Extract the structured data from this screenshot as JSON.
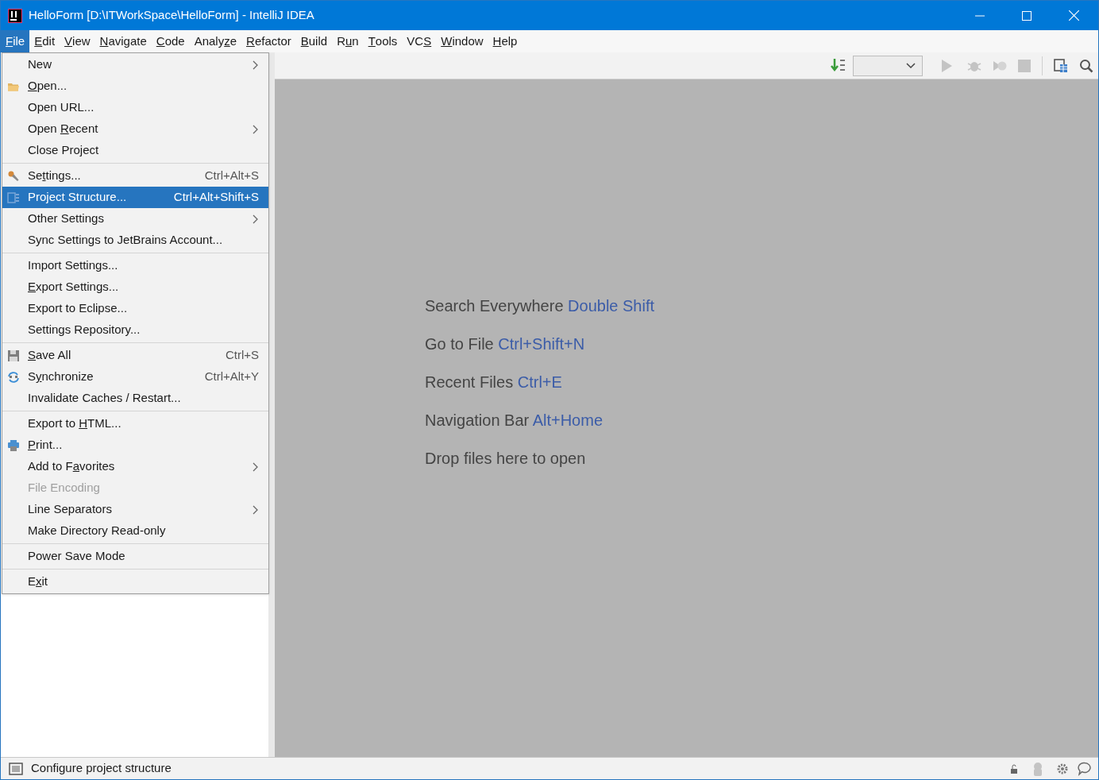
{
  "window": {
    "title": "HelloForm [D:\\ITWorkSpace\\HelloForm] - IntelliJ IDEA"
  },
  "menu_bar": [
    {
      "label": {
        "key": "F",
        "post": "ile"
      },
      "selected": true
    },
    {
      "label": {
        "key": "E",
        "post": "dit"
      },
      "selected": false
    },
    {
      "label": {
        "key": "V",
        "post": "iew"
      },
      "selected": false
    },
    {
      "label": {
        "key": "N",
        "post": "avigate"
      },
      "selected": false
    },
    {
      "label": {
        "key": "C",
        "post": "ode"
      },
      "selected": false
    },
    {
      "label": {
        "pre": "Analy",
        "key": "z",
        "post": "e"
      },
      "selected": false
    },
    {
      "label": {
        "key": "R",
        "post": "efactor"
      },
      "selected": false
    },
    {
      "label": {
        "key": "B",
        "post": "uild"
      },
      "selected": false
    },
    {
      "label": {
        "pre": "R",
        "key": "u",
        "post": "n"
      },
      "selected": false
    },
    {
      "label": {
        "key": "T",
        "post": "ools"
      },
      "selected": false
    },
    {
      "label": {
        "pre": "VC",
        "key": "S"
      },
      "selected": false
    },
    {
      "label": {
        "key": "W",
        "post": "indow"
      },
      "selected": false
    },
    {
      "label": {
        "key": "H",
        "post": "elp"
      },
      "selected": false
    }
  ],
  "file_menu": [
    [
      {
        "label": {
          "pre": "New"
        },
        "submenu": true,
        "selected": false,
        "disabled": false
      },
      {
        "label": {
          "key": "O",
          "post": "pen..."
        },
        "submenu": false,
        "selected": false,
        "disabled": false
      },
      {
        "label": {
          "pre": "Open URL..."
        },
        "submenu": false,
        "selected": false,
        "disabled": false
      },
      {
        "label": {
          "pre": "Open ",
          "key": "R",
          "post": "ecent"
        },
        "submenu": true,
        "selected": false,
        "disabled": false
      },
      {
        "label": {
          "pre": "Close Project"
        },
        "submenu": false,
        "selected": false,
        "disabled": false
      }
    ],
    [
      {
        "label": {
          "pre": "Se",
          "key": "t",
          "post": "tings..."
        },
        "shortcut": "Ctrl+Alt+S",
        "submenu": false,
        "selected": false,
        "disabled": false
      },
      {
        "label": {
          "pre": "Project Structure..."
        },
        "shortcut": "Ctrl+Alt+Shift+S",
        "submenu": false,
        "selected": true,
        "disabled": false
      },
      {
        "label": {
          "pre": "Other Settings"
        },
        "submenu": true,
        "selected": false,
        "disabled": false
      },
      {
        "label": {
          "pre": "Sync Settings to JetBrains Account..."
        },
        "submenu": false,
        "selected": false,
        "disabled": false
      }
    ],
    [
      {
        "label": {
          "pre": "Import Settings..."
        },
        "submenu": false,
        "selected": false,
        "disabled": false
      },
      {
        "label": {
          "key": "E",
          "post": "xport Settings..."
        },
        "submenu": false,
        "selected": false,
        "disabled": false
      },
      {
        "label": {
          "pre": "Export to Eclipse..."
        },
        "submenu": false,
        "selected": false,
        "disabled": false
      },
      {
        "label": {
          "pre": "Settings Repository..."
        },
        "submenu": false,
        "selected": false,
        "disabled": false
      }
    ],
    [
      {
        "label": {
          "key": "S",
          "post": "ave All"
        },
        "shortcut": "Ctrl+S",
        "submenu": false,
        "selected": false,
        "disabled": false
      },
      {
        "label": {
          "pre": "S",
          "key": "y",
          "post": "nchronize"
        },
        "shortcut": "Ctrl+Alt+Y",
        "submenu": false,
        "selected": false,
        "disabled": false
      },
      {
        "label": {
          "pre": "Invalidate Caches / Restart..."
        },
        "submenu": false,
        "selected": false,
        "disabled": false
      }
    ],
    [
      {
        "label": {
          "pre": "Export to ",
          "key": "H",
          "post": "TML..."
        },
        "submenu": false,
        "selected": false,
        "disabled": false
      },
      {
        "label": {
          "key": "P",
          "post": "rint..."
        },
        "submenu": false,
        "selected": false,
        "disabled": false
      },
      {
        "label": {
          "pre": "Add to F",
          "key": "a",
          "post": "vorites"
        },
        "submenu": true,
        "selected": false,
        "disabled": false
      },
      {
        "label": {
          "pre": "File Encoding"
        },
        "submenu": false,
        "selected": false,
        "disabled": true
      },
      {
        "label": {
          "pre": "Line Separators"
        },
        "submenu": true,
        "selected": false,
        "disabled": false
      },
      {
        "label": {
          "pre": "Make Directory Read-only"
        },
        "submenu": false,
        "selected": false,
        "disabled": false
      }
    ],
    [
      {
        "label": {
          "pre": "Power Save Mode"
        },
        "submenu": false,
        "selected": false,
        "disabled": false
      }
    ],
    [
      {
        "label": {
          "pre": "E",
          "key": "x",
          "post": "it"
        },
        "submenu": false,
        "selected": false,
        "disabled": false
      }
    ]
  ],
  "hints": [
    {
      "text": "Search Everywhere",
      "shortcut": "Double Shift"
    },
    {
      "text": "Go to File",
      "shortcut": "Ctrl+Shift+N"
    },
    {
      "text": "Recent Files",
      "shortcut": "Ctrl+E"
    },
    {
      "text": "Navigation Bar",
      "shortcut": "Alt+Home"
    },
    {
      "text": "Drop files here to open"
    }
  ],
  "status_bar": {
    "text": "Configure project structure"
  }
}
